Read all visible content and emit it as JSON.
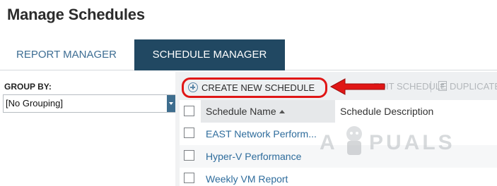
{
  "page": {
    "title": "Manage Schedules"
  },
  "tabs": [
    {
      "label": "REPORT MANAGER",
      "active": false
    },
    {
      "label": "SCHEDULE MANAGER",
      "active": true
    }
  ],
  "sidebar": {
    "group_by_label": "GROUP BY:",
    "group_by_value": "[No Grouping]"
  },
  "toolbar": {
    "create_label": "CREATE NEW SCHEDULE",
    "edit_label": "EDIT SCHEDULE",
    "duplicate_label": "DUPLICATE"
  },
  "table": {
    "columns": [
      "Schedule Name",
      "Schedule Description"
    ],
    "rows": [
      {
        "name": "EAST Network Perform..."
      },
      {
        "name": "Hyper-V Performance"
      },
      {
        "name": "Weekly VM Report"
      }
    ]
  },
  "watermark": {
    "text_left": "A",
    "text_right": "PUALS"
  },
  "colors": {
    "tab_active_bg": "#214862",
    "link": "#2e6c9c",
    "highlight_red": "#e01616"
  }
}
